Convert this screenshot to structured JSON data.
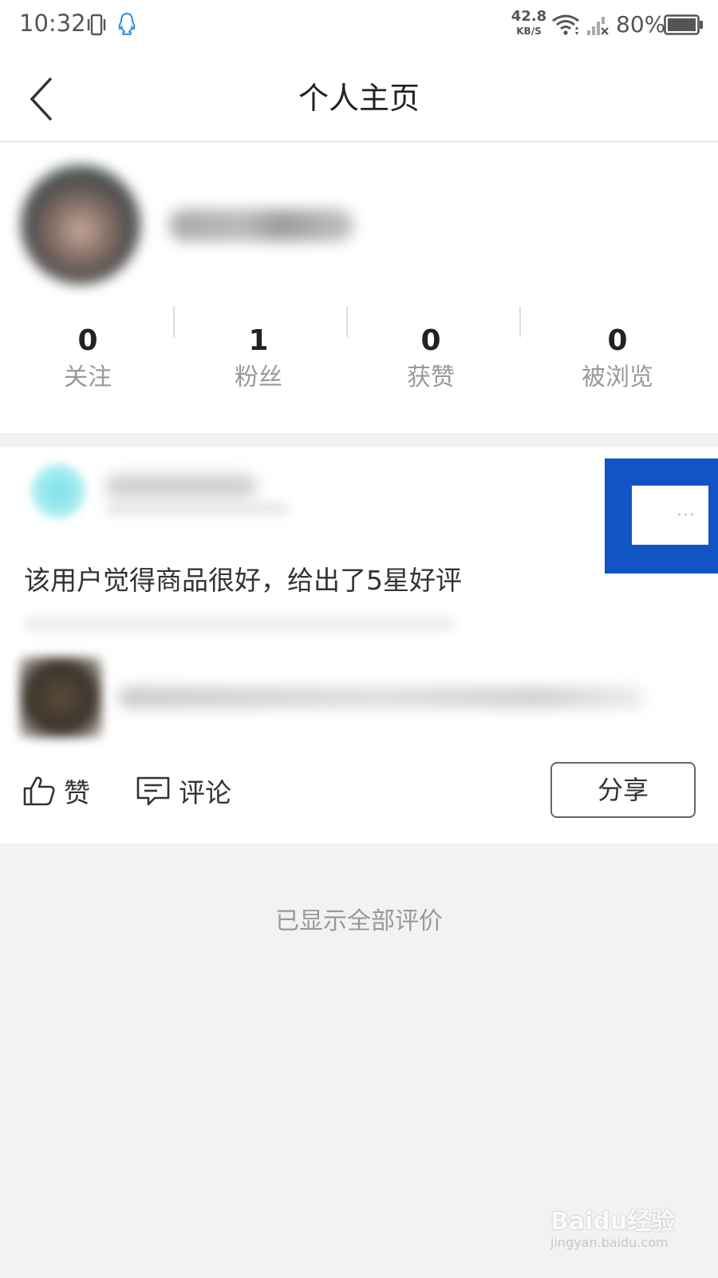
{
  "status_bar": {
    "time": "10:32",
    "net_speed_value": "42.8",
    "net_speed_unit": "KB/S",
    "battery": "80%",
    "icons": [
      "vibrate-icon",
      "qq-icon",
      "wifi-icon",
      "signal-icon",
      "battery-icon"
    ]
  },
  "header": {
    "title": "个人主页",
    "back_icon": "chevron-left-icon"
  },
  "profile": {
    "stats": [
      {
        "value": "0",
        "label": "关注"
      },
      {
        "value": "1",
        "label": "粉丝"
      },
      {
        "value": "0",
        "label": "获赞"
      },
      {
        "value": "0",
        "label": "被浏览"
      }
    ]
  },
  "review": {
    "text": "该用户觉得商品很好，给出了5星好评",
    "more_label": "···",
    "highlight_color": "#1155c4",
    "actions": {
      "like_label": "赞",
      "comment_label": "评论",
      "share_label": "分享"
    }
  },
  "footer": {
    "end_text": "已显示全部评价"
  },
  "watermark": {
    "main": "Baidu经验",
    "sub": "jingyan.baidu.com"
  }
}
